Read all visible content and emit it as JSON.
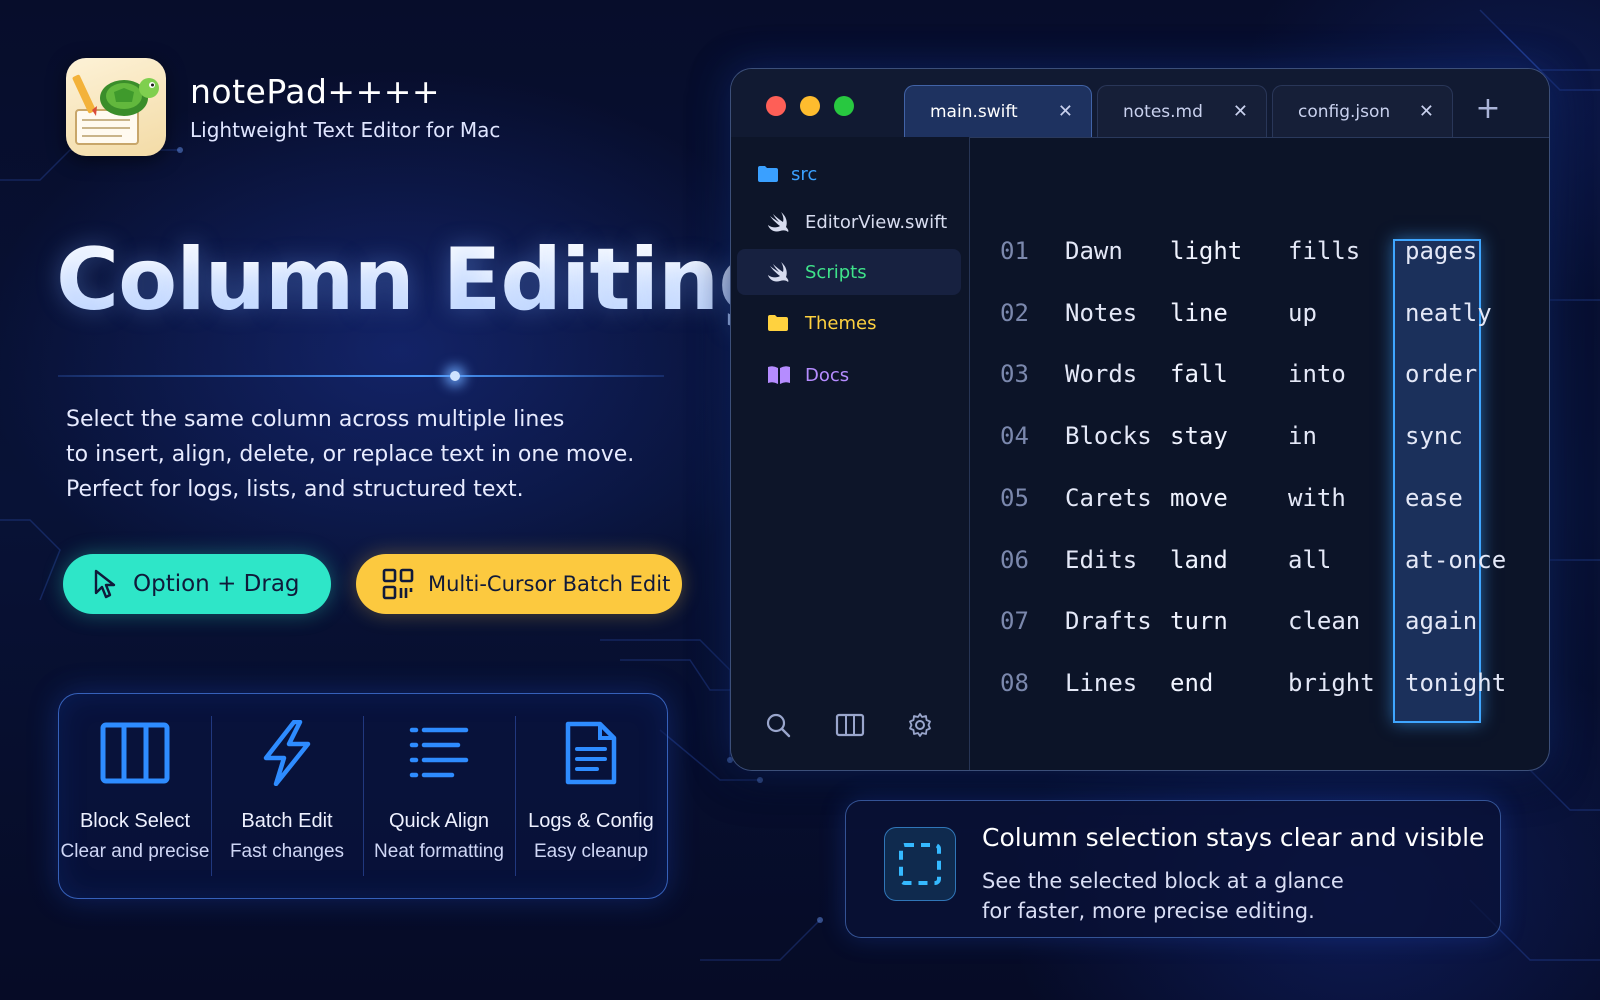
{
  "brand": {
    "app_icon": "turtle-notepad-app-icon",
    "name": "notePad++++",
    "tagline": "Lightweight Text Editor for Mac"
  },
  "headline": "Column Editing",
  "description": [
    "Select the same column across multiple lines",
    "to insert, align, delete, or replace text in one move.",
    "Perfect for logs, lists, and structured text."
  ],
  "buttons": {
    "option_drag": {
      "label": "Option + Drag",
      "icon": "cursor-arrow-icon",
      "color": "#2ee6c8"
    },
    "multi_cursor": {
      "label": "Multi-Cursor Batch Edit",
      "icon": "grid-icon",
      "color": "#fcc93f"
    }
  },
  "features": [
    {
      "icon": "columns-icon",
      "title": "Block Select",
      "subtitle": "Clear and precise"
    },
    {
      "icon": "lightning-icon",
      "title": "Batch Edit",
      "subtitle": "Fast changes"
    },
    {
      "icon": "align-lines-icon",
      "title": "Quick Align",
      "subtitle": "Neat formatting"
    },
    {
      "icon": "document-icon",
      "title": "Logs & Config",
      "subtitle": "Easy cleanup"
    }
  ],
  "editor": {
    "tabs": [
      {
        "label": "main.swift",
        "active": true
      },
      {
        "label": "notes.md",
        "active": false
      },
      {
        "label": "config.json",
        "active": false
      }
    ],
    "sidebar": [
      {
        "label": "src",
        "icon": "folder-icon",
        "color": "#3aa0ff"
      },
      {
        "label": "EditorView.swift",
        "icon": "swift-icon",
        "color": "#d7dcef"
      },
      {
        "label": "Scripts",
        "icon": "swift-icon",
        "color": "#3fe38a",
        "selected": true
      },
      {
        "label": "Themes",
        "icon": "folder-icon",
        "color": "#ffd23f"
      },
      {
        "label": "Docs",
        "icon": "book-icon",
        "color": "#b58cff"
      }
    ],
    "sidebar_tools": [
      "search-icon",
      "split-view-icon",
      "gear-icon"
    ],
    "selected_column": 2,
    "lines": [
      {
        "num": "01",
        "words": [
          "Dawn",
          "light",
          "fills",
          "pages"
        ]
      },
      {
        "num": "02",
        "words": [
          "Notes",
          "line",
          "up",
          "neatly"
        ]
      },
      {
        "num": "03",
        "words": [
          "Words",
          "fall",
          "into",
          "order"
        ]
      },
      {
        "num": "04",
        "words": [
          "Blocks",
          "stay",
          "in",
          "sync"
        ]
      },
      {
        "num": "05",
        "words": [
          "Carets",
          "move",
          "with",
          "ease"
        ]
      },
      {
        "num": "06",
        "words": [
          "Edits",
          "land",
          "all",
          "at-once"
        ]
      },
      {
        "num": "07",
        "words": [
          "Drafts",
          "turn",
          "clean",
          "again"
        ]
      },
      {
        "num": "08",
        "words": [
          "Lines",
          "end",
          "bright",
          "tonight"
        ]
      }
    ]
  },
  "info_card": {
    "icon": "selection-box-icon",
    "title": "Column selection stays clear and visible",
    "lines": [
      "See the selected block at a glance",
      "for faster, more precise editing."
    ]
  }
}
